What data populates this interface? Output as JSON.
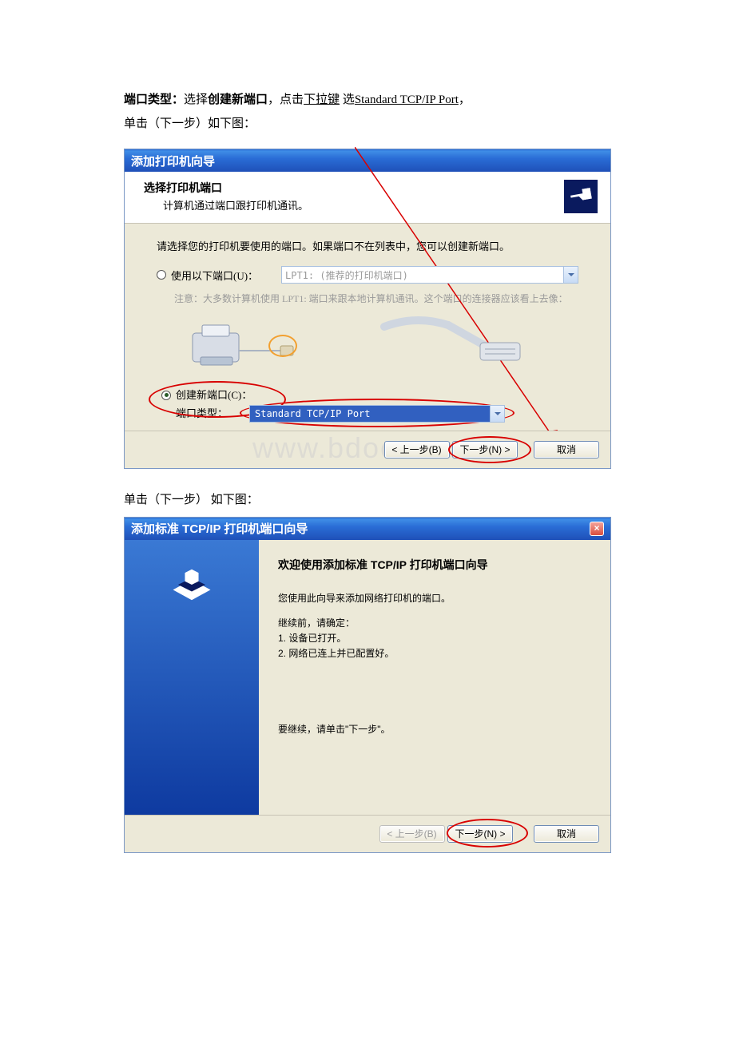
{
  "doc": {
    "line1_pre": "端口类型：",
    "line1_bold": "选择",
    "line1_bold2": "创建新端口",
    "line1_mid": "，点击",
    "line1_u1": "下拉键",
    "line1_mid2": " 选",
    "line1_u2": "Standard TCP/IP Port",
    "line1_end": "，",
    "line2": "单击（下一步）如下图：",
    "line3": "单击（下一步） 如下图："
  },
  "wiz1": {
    "title": "添加打印机向导",
    "header_bold": "选择打印机端口",
    "header_sub": "计算机通过端口跟打印机通讯。",
    "instruction": "请选择您的打印机要使用的端口。如果端口不在列表中，您可以创建新端口。",
    "radio_use_label": "使用以下端口(U)：",
    "combo_disabled": "LPT1: (推荐的打印机端口)",
    "note_line": "注意：大多数计算机使用 LPT1: 端口来跟本地计算机通讯。这个端口的连接器应该看上去像：",
    "radio_create_label": "创建新端口(C)：",
    "port_type_label": "端口类型：",
    "combo_selected": "Standard TCP/IP Port",
    "btn_back": "< 上一步(B)",
    "btn_next": "下一步(N) >",
    "btn_cancel": "取消"
  },
  "watermark": "www.bdoox.com",
  "wiz2": {
    "title": "添加标准 TCP/IP 打印机端口向导",
    "heading": "欢迎使用添加标准 TCP/IP 打印机端口向导",
    "p1": "您使用此向导来添加网络打印机的端口。",
    "p2a": "继续前，请确定：",
    "p2b": "1.  设备已打开。",
    "p2c": "2.  网络已连上并已配置好。",
    "cont": "要继续，请单击\"下一步\"。",
    "btn_back": "< 上一步(B)",
    "btn_next": "下一步(N) >",
    "btn_cancel": "取消"
  }
}
